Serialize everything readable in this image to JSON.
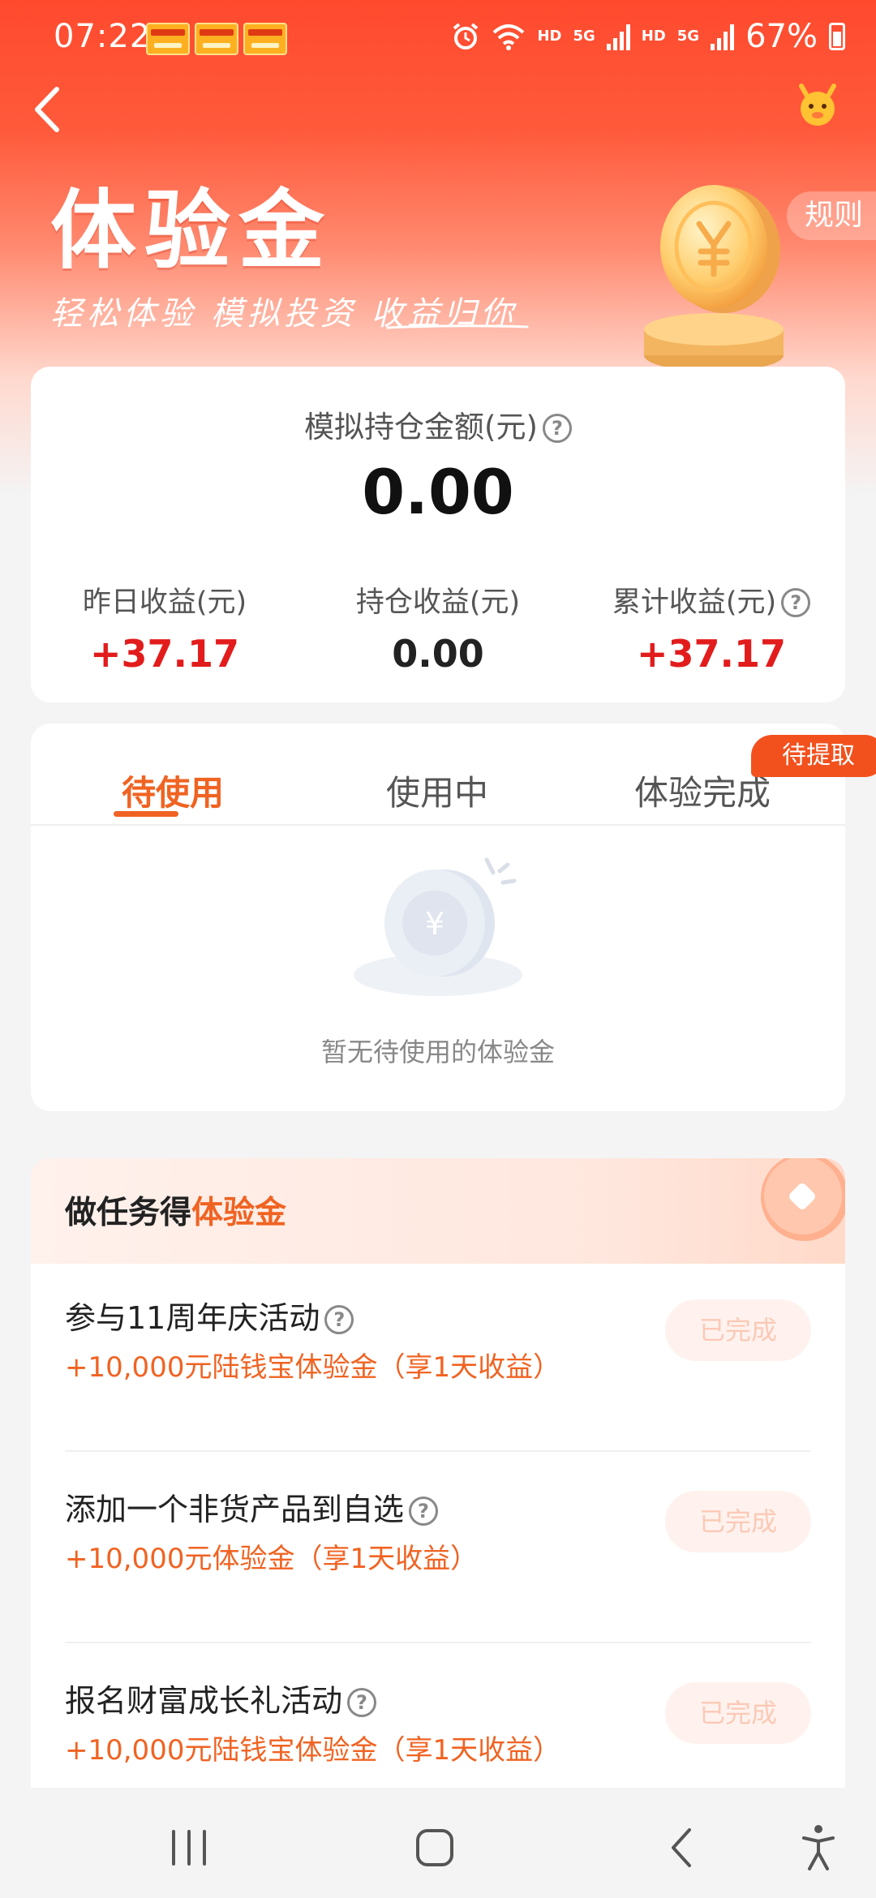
{
  "status_bar": {
    "time": "07:22",
    "network_1": "HD",
    "network_2": "HD",
    "signal_tag": "5G",
    "battery": "67%"
  },
  "header": {
    "rules_label": "规则",
    "title": "体验金",
    "subtitle": "轻松体验 模拟投资 收益归你"
  },
  "holding": {
    "label": "模拟持仓金额(元)",
    "amount": "0.00",
    "stats": [
      {
        "label": "昨日收益(元)",
        "value": "+37.17"
      },
      {
        "label": "持仓收益(元)",
        "value": "0.00"
      },
      {
        "label": "累计收益(元)",
        "value": "+37.17"
      }
    ]
  },
  "tabs": {
    "items": [
      {
        "label": "待使用"
      },
      {
        "label": "使用中"
      },
      {
        "label": "体验完成"
      }
    ],
    "badge": "待提取",
    "empty_text": "暂无待使用的体验金",
    "empty_coin_symbol": "¥"
  },
  "tasks": {
    "title_prefix": "做任务得",
    "title_accent": "体验金",
    "items": [
      {
        "name": "参与11周年庆活动",
        "reward": "+10,000元陆钱宝体验金（享1天收益）",
        "button": "已完成"
      },
      {
        "name": "添加一个非货产品到自选",
        "reward": "+10,000元体验金（享1天收益）",
        "button": "已完成"
      },
      {
        "name": "报名财富成长礼活动",
        "reward": "+10,000元陆钱宝体验金（享1天收益）",
        "button": "已完成"
      }
    ]
  },
  "help_symbol": "?",
  "colors": {
    "brand": "#ff4a2e",
    "accent": "#f06322",
    "profit": "#e21c1c"
  },
  "icons": {
    "back": "back-chevron-icon",
    "mascot": "mascot-icon",
    "coin": "coin-icon",
    "help": "help-circle-icon",
    "nav_recents": "recents-icon",
    "nav_home": "home-icon",
    "nav_back": "nav-back-icon",
    "nav_accessibility": "accessibility-icon"
  }
}
